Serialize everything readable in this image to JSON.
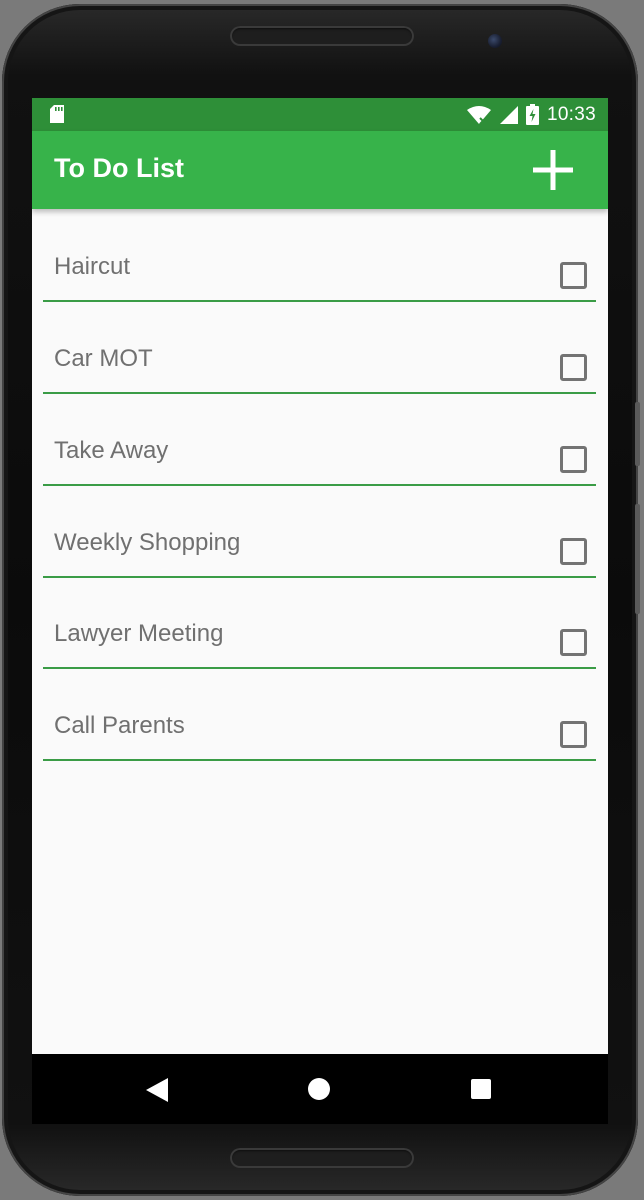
{
  "status_bar": {
    "time": "10:33",
    "icons": [
      "sd-card-icon",
      "wifi-icon",
      "signal-icon",
      "battery-charging-icon"
    ]
  },
  "app_bar": {
    "title": "To Do List",
    "add_icon": "plus-icon"
  },
  "todo_items": [
    {
      "label": "Haircut",
      "checked": false
    },
    {
      "label": "Car MOT",
      "checked": false
    },
    {
      "label": "Take Away",
      "checked": false
    },
    {
      "label": "Weekly Shopping",
      "checked": false
    },
    {
      "label": "Lawyer Meeting",
      "checked": false
    },
    {
      "label": "Call Parents",
      "checked": false
    }
  ],
  "nav_bar": {
    "icons": [
      "back-icon",
      "home-icon",
      "recent-apps-icon"
    ]
  },
  "colors": {
    "app_bar": "#37b34a",
    "status_bar": "#2e8f38",
    "divider": "#3a9c46",
    "background": "#fafafa",
    "text": "#707070"
  }
}
